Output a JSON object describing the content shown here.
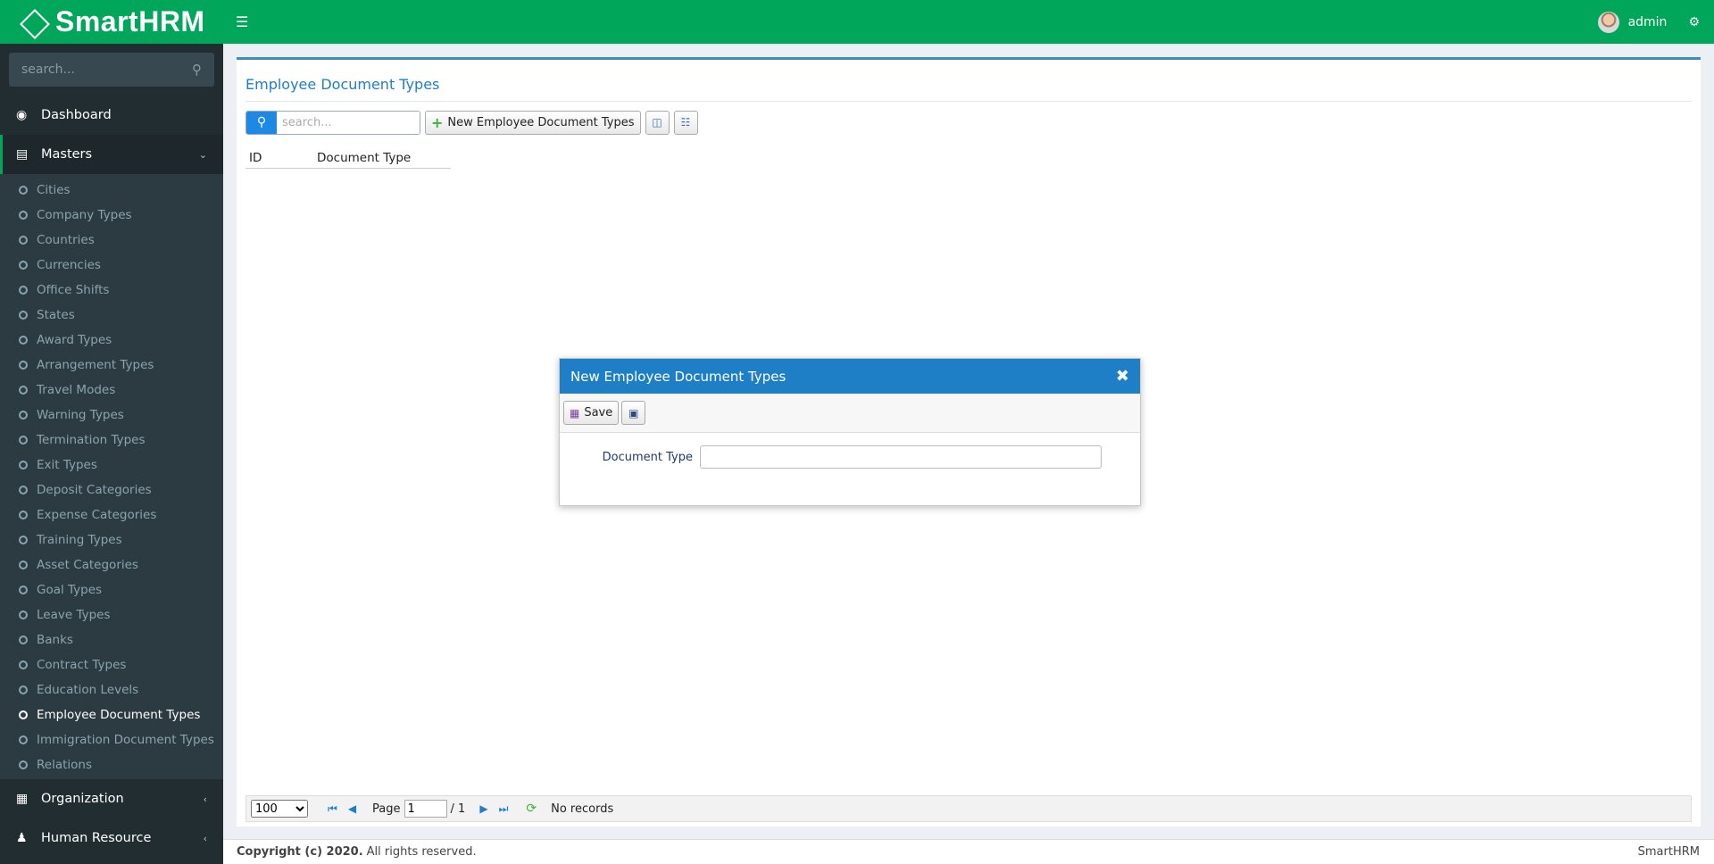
{
  "brand": {
    "name": "SmartHRM"
  },
  "sidebar": {
    "search_placeholder": "search...",
    "dashboard": "Dashboard",
    "masters": "Masters",
    "master_items": [
      "Cities",
      "Company Types",
      "Countries",
      "Currencies",
      "Office Shifts",
      "States",
      "Award Types",
      "Arrangement Types",
      "Travel Modes",
      "Warning Types",
      "Termination Types",
      "Exit Types",
      "Deposit Categories",
      "Expense Categories",
      "Training Types",
      "Asset Categories",
      "Goal Types",
      "Leave Types",
      "Banks",
      "Contract Types",
      "Education Levels",
      "Employee Document Types",
      "Immigration Document Types",
      "Relations"
    ],
    "active_item": "Employee Document Types",
    "organization": "Organization",
    "human_resource": "Human Resource"
  },
  "header": {
    "user": "admin"
  },
  "page": {
    "title": "Employee Document Types",
    "search_placeholder": "search...",
    "new_button": "New Employee Document Types",
    "columns": [
      "ID",
      "Document Type"
    ]
  },
  "pager": {
    "page_size": "100",
    "page_label": "Page",
    "page_value": "1",
    "page_total": "/ 1",
    "status": "No records"
  },
  "footer": {
    "copyright_bold": "Copyright (c) 2020.",
    "copyright_rest": "All rights reserved.",
    "right": "SmartHRM"
  },
  "modal": {
    "title": "New Employee Document Types",
    "save_label": "Save",
    "field_label": "Document Type",
    "field_value": ""
  },
  "colors": {
    "header": "#00a65a",
    "sidebar": "#222d32",
    "accent": "#1e7fc7"
  }
}
